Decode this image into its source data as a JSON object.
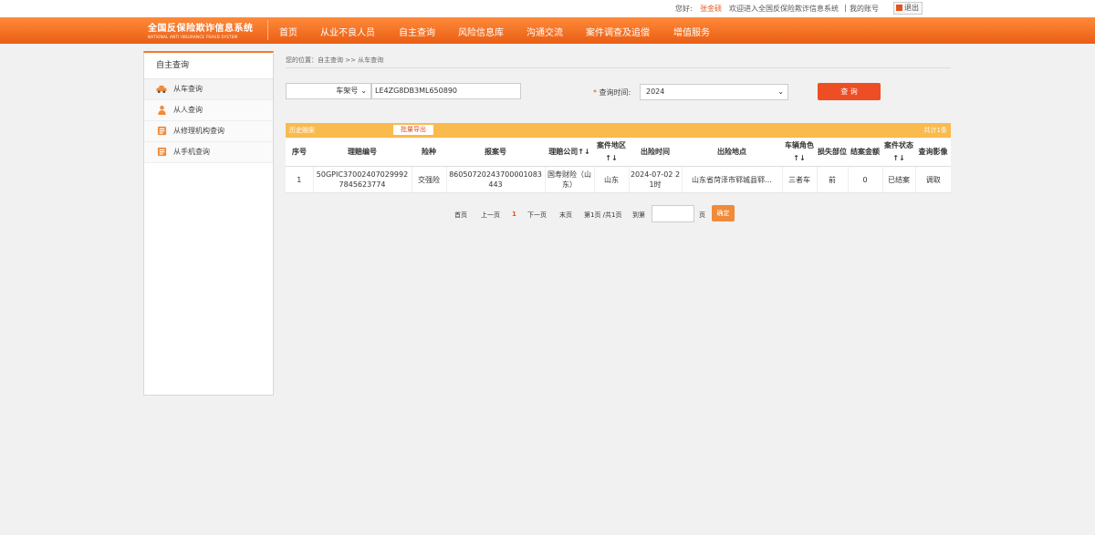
{
  "topbar": {
    "greeting": "您好:",
    "user": "张金硕",
    "welcome": "欢迎进入全国反保险欺诈信息系统",
    "sep": "|",
    "my_account": "我的账号",
    "logout": "退出"
  },
  "logo": {
    "title": "全国反保险欺诈信息系统",
    "subtitle": "NATIONAL ANTI INSURANCE FRAUD SYSTEM"
  },
  "nav": [
    "首页",
    "从业不良人员",
    "自主查询",
    "风险信息库",
    "沟通交流",
    "案件调查及追偿",
    "增值服务"
  ],
  "sidebar": {
    "title": "自主查询",
    "items": [
      {
        "label": "从车查询",
        "icon": "car-icon"
      },
      {
        "label": "从人查询",
        "icon": "person-icon"
      },
      {
        "label": "从修理机构查询",
        "icon": "repair-shop-icon"
      },
      {
        "label": "从手机查询",
        "icon": "phone-icon"
      }
    ]
  },
  "breadcrumb": "您的位置：自主查询 >> 从车查询",
  "search": {
    "type_value": "车架号",
    "vin_value": "LE4ZG8DB3ML650890",
    "time_label": "查询时间:",
    "required_mark": "*",
    "year_value": "2024",
    "query_button": "查 询"
  },
  "history": {
    "label": "历史赔案",
    "export_button": "批量导出",
    "total": "共计1条"
  },
  "table": {
    "headers": [
      "序号",
      "理赔编号",
      "险种",
      "报案号",
      "理赔公司↑↓",
      "案件地区↑↓",
      "出险时间",
      "出险地点",
      "车辆角色↑↓",
      "损失部位",
      "结案金额",
      "案件状态↑↓",
      "查询影像"
    ],
    "rows": [
      [
        "1",
        "50GPIC370024070299927845623774",
        "交强险",
        "86050720243700001083443",
        "国寿财险（山东）",
        "山东",
        "2024-07-02 21时",
        "山东省菏泽市郓城县郓…",
        "三者车",
        "前",
        "0",
        "已结案",
        "调取"
      ]
    ]
  },
  "pagination": {
    "first": "首页",
    "prev": "上一页",
    "current": "1",
    "next": "下一页",
    "last": "末页",
    "info": "第1页 /共1页",
    "goto": "到第",
    "page_unit": "页",
    "confirm": "确定"
  },
  "colors": {
    "brand_orange": "#ee6a1f",
    "query_button": "#ee4e23",
    "history_bar": "#f9ba4e"
  }
}
